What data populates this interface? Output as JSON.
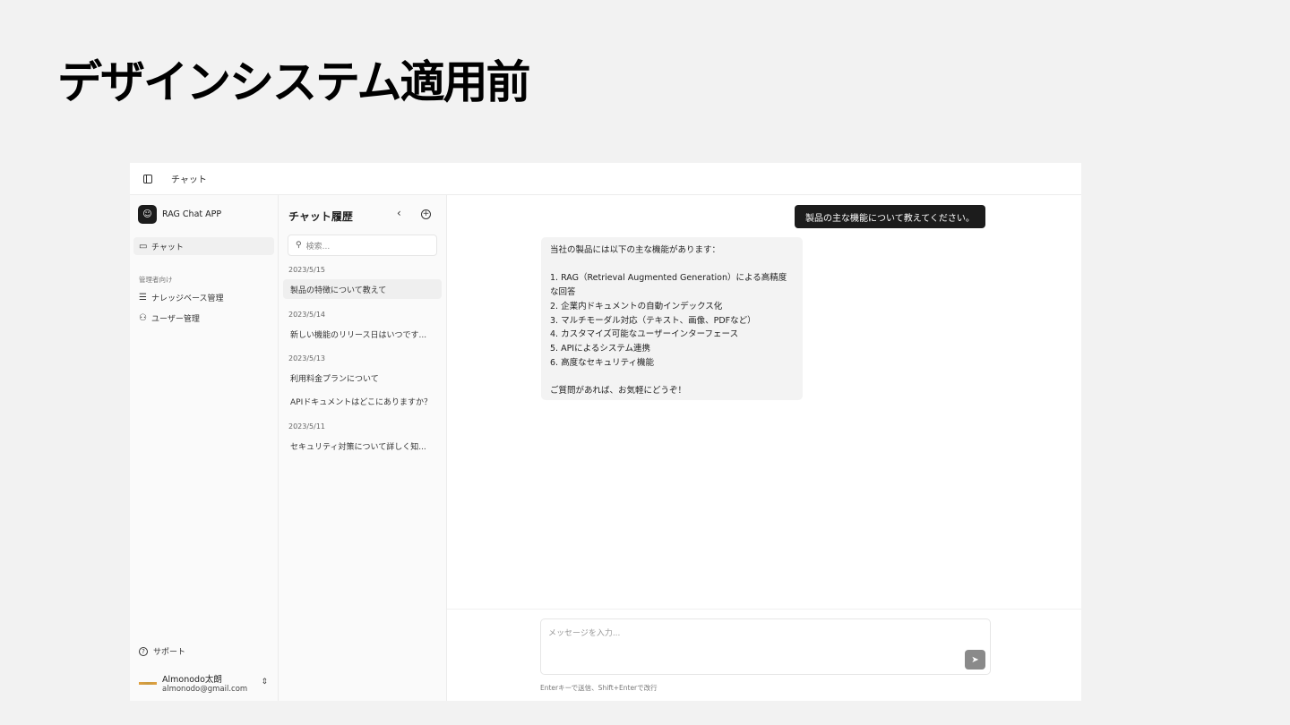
{
  "slide": {
    "title": "デザインシステム適用前"
  },
  "topbar": {
    "title": "チャット"
  },
  "sidebar": {
    "brand": "RAG Chat APP",
    "chat_label": "チャット",
    "section_label": "管理者向け",
    "items": [
      {
        "label": "ナレッジベース管理",
        "icon": "database-icon"
      },
      {
        "label": "ユーザー管理",
        "icon": "users-icon"
      }
    ],
    "support_label": "サポート",
    "user": {
      "name": "Almonodo太朗",
      "email": "almonodo@gmail.com"
    }
  },
  "history": {
    "title": "チャット履歴",
    "search_placeholder": "検索...",
    "groups": [
      {
        "date": "2023/5/15",
        "items": [
          "製品の特徴について教えて"
        ]
      },
      {
        "date": "2023/5/14",
        "items": [
          "新しい機能のリリース日はいつです..."
        ]
      },
      {
        "date": "2023/5/13",
        "items": [
          "利用料金プランについて",
          "APIドキュメントはどこにありますか？"
        ]
      },
      {
        "date": "2023/5/11",
        "items": [
          "セキュリティ対策について詳しく知..."
        ]
      }
    ]
  },
  "chat": {
    "user_message": "製品の主な機能について教えてください。",
    "bot_lines": [
      "当社の製品には以下の主な機能があります：",
      "",
      "1. RAG（Retrieval Augmented Generation）による高精度",
      "な回答",
      "2. 企業内ドキュメントの自動インデックス化",
      "3. マルチモーダル対応（テキスト、画像、PDFなど）",
      "4. カスタマイズ可能なユーザーインターフェース",
      "5. APIによるシステム連携",
      "6. 高度なセキュリティ機能",
      "",
      "ご質問があれば、お気軽にどうぞ！"
    ],
    "input_placeholder": "メッセージを入力...",
    "hint": "Enterキーで送信、Shift+Enterで改行"
  }
}
